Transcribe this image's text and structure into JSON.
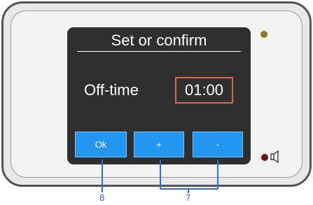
{
  "screen": {
    "title": "Set or confirm",
    "field_label": "Off-time",
    "field_value": "01:00"
  },
  "buttons": {
    "ok_label": "Ok",
    "plus_label": "+",
    "minus_label": "-"
  },
  "indicators": {
    "top_led_color": "#8d7a1c",
    "bottom_led_color": "#6b1313",
    "speaker_icon": "speaker-icon"
  },
  "callouts": {
    "ok_number": "8",
    "plus_minus_number": "7"
  },
  "colors": {
    "button_blue": "#2596f0",
    "value_border": "#d9685a",
    "callout_blue": "#2a6fd6",
    "screen_bg": "#2f2f2f"
  }
}
